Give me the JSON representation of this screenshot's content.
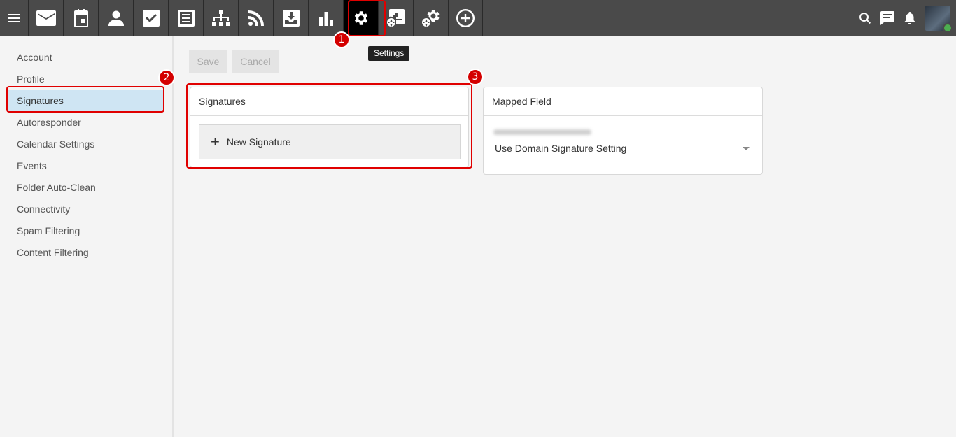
{
  "topbar": {
    "nav_icons": [
      "mail-icon",
      "calendar-icon",
      "contacts-icon",
      "tasks-icon",
      "notes-icon",
      "sitemap-icon",
      "rss-icon",
      "archive-icon",
      "reports-icon",
      "settings-icon",
      "domain-reports-icon",
      "domain-settings-icon",
      "add-icon"
    ],
    "active": "settings-icon",
    "right_icons": [
      "search-icon",
      "chat-icon",
      "bell-icon",
      "avatar"
    ]
  },
  "tooltip": "Settings",
  "sidebar": {
    "items": [
      {
        "label": "Account"
      },
      {
        "label": "Profile"
      },
      {
        "label": "Signatures",
        "active": true
      },
      {
        "label": "Autoresponder"
      },
      {
        "label": "Calendar Settings"
      },
      {
        "label": "Events"
      },
      {
        "label": "Folder Auto-Clean"
      },
      {
        "label": "Connectivity"
      },
      {
        "label": "Spam Filtering"
      },
      {
        "label": "Content Filtering"
      }
    ]
  },
  "toolbar": {
    "save_label": "Save",
    "cancel_label": "Cancel"
  },
  "signatures_panel": {
    "title": "Signatures",
    "new_button": "New Signature",
    "plus": "+"
  },
  "mapped_panel": {
    "title": "Mapped Field",
    "select_value": "Use Domain Signature Setting"
  },
  "annotations": [
    "1",
    "2",
    "3"
  ],
  "colors": {
    "topbar": "#4a4a4a",
    "active_nav": "#000000",
    "sidebar_active": "#cfe5f3",
    "annotation": "#e00000"
  }
}
